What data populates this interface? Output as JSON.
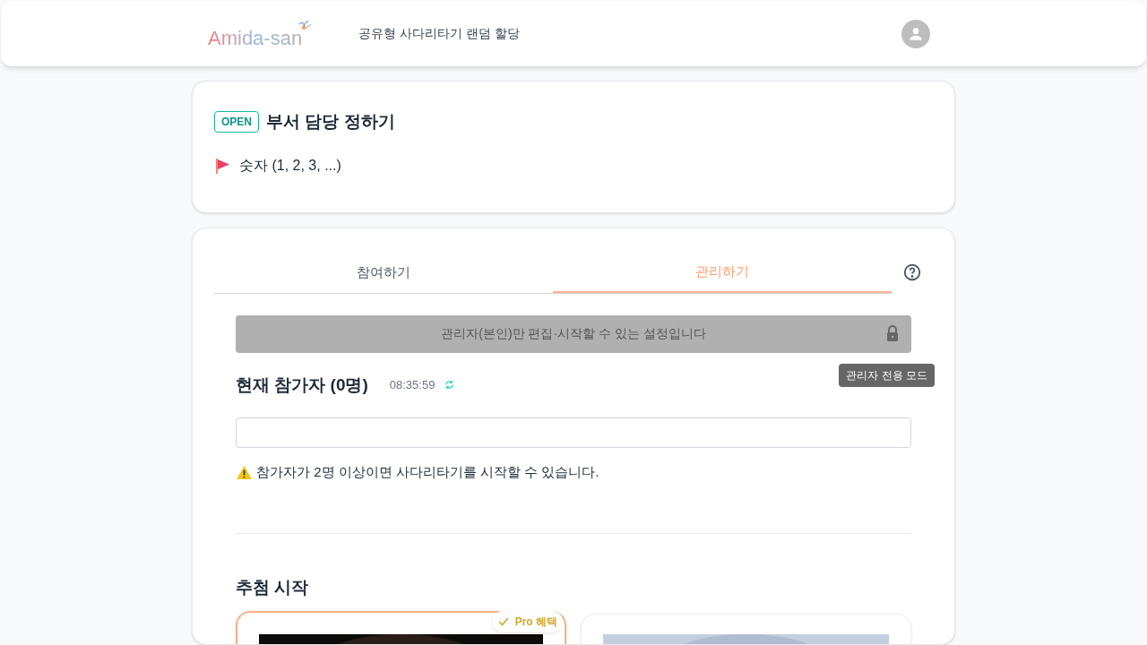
{
  "header": {
    "logo": "Amida-san",
    "title": "공유형 사다리타기 랜덤 할당"
  },
  "event": {
    "status": "OPEN",
    "title": "부서 담당 정하기",
    "numbering": "숫자 (1, 2, 3, ...)"
  },
  "tabs": [
    {
      "label": "참여하기",
      "selected": false
    },
    {
      "label": "관리하기",
      "selected": true
    }
  ],
  "admin_notice": "관리자(본인)만 편집·시작할 수 있는 설정입니다",
  "tooltip": "관리자 전용 모드",
  "participants": {
    "title": "현재 참가자 (0명)",
    "time": "08:35:59",
    "warning": "참가자가 2명 이상이면 사다리타기를 시작할 수 있습니다."
  },
  "draw": {
    "title": "추첨 시작",
    "options": [
      {
        "selected": true,
        "badge": "Pro 혜택",
        "kind": "picture"
      },
      {
        "selected": false,
        "kind": "picture"
      }
    ]
  }
}
